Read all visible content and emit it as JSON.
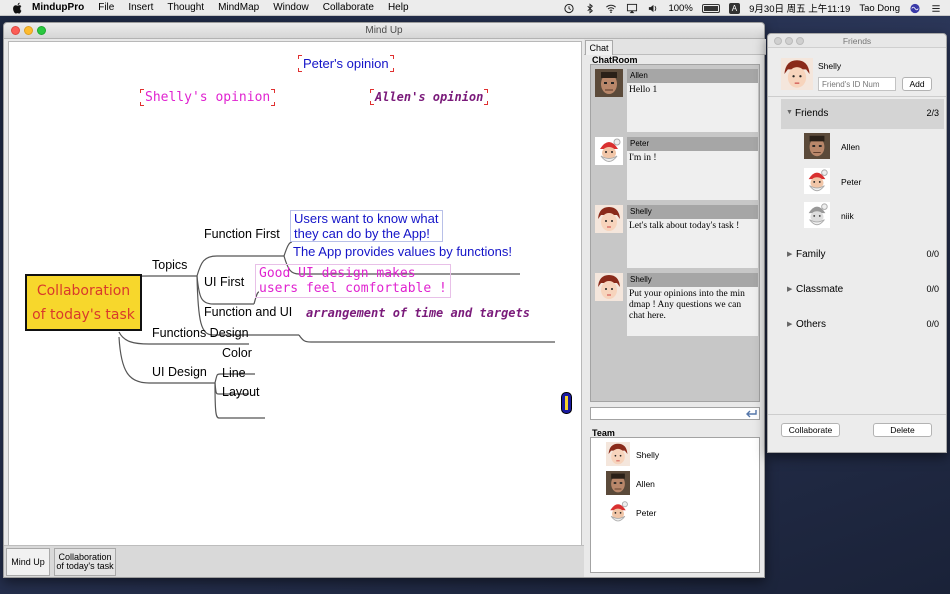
{
  "menubar": {
    "apple_icon": "apple-icon",
    "app_name": "MindupPro",
    "items": [
      "File",
      "Insert",
      "Thought",
      "MindMap",
      "Window",
      "Collaborate",
      "Help"
    ],
    "status": {
      "battery_label": "100%",
      "ime": "A",
      "datetime": "9月30日 周五 上午11:19",
      "user": "Tao Dong"
    }
  },
  "main_window": {
    "title": "Mind Up",
    "mindmap": {
      "root": [
        "Collaboration",
        "of today's task"
      ],
      "opinions": {
        "peter": "Peter's opinion",
        "shelly": "Shelly's opinion",
        "allen": "Allen's opinion"
      },
      "branches": {
        "topics": "Topics",
        "functions_design": "Functions Design",
        "ui_design": "UI Design",
        "function_first": "Function First",
        "ui_first": "UI First",
        "function_and_ui": "Function and UI",
        "color": "Color",
        "line": "Line",
        "layout": "Layout"
      },
      "notes": {
        "users_want_1": "Users want to know what",
        "users_want_2": "they can do by the App!",
        "app_provides": "The App provides values by functions!",
        "good_ui_1": "Good UI design makes",
        "good_ui_2": "users feel comfortable !",
        "arrangement": "arrangement of time and targets"
      }
    },
    "doc_tabs": {
      "mindup": "Mind Up",
      "collab_1": "Collaboration",
      "collab_2": "of today's task"
    },
    "chat": {
      "tab": "Chat",
      "chatroom_label": "ChatRoom",
      "team_label": "Team",
      "messages": [
        {
          "sender": "Allen",
          "text": "Hello 1"
        },
        {
          "sender": "Peter",
          "text": "I'm in !"
        },
        {
          "sender": "Shelly",
          "text": "Let's talk about today's task !"
        },
        {
          "sender": "Shelly",
          "text": "Put your opinions into the min dmap ! Any questions we can chat here."
        }
      ],
      "team": [
        "Shelly",
        "Allen",
        "Peter"
      ]
    }
  },
  "friends_window": {
    "title": "Friends",
    "me": "Shelly",
    "id_placeholder": "Friend's ID Num",
    "add_label": "Add",
    "groups": {
      "friends": {
        "name": "Friends",
        "count": "2/3",
        "members": [
          "Allen",
          "Peter",
          "niik"
        ]
      },
      "family": {
        "name": "Family",
        "count": "0/0"
      },
      "classmate": {
        "name": "Classmate",
        "count": "0/0"
      },
      "others": {
        "name": "Others",
        "count": "0/0"
      }
    },
    "collaborate_label": "Collaborate",
    "delete_label": "Delete"
  },
  "colors": {
    "root_fill": "#f7d72c",
    "root_text": "#d93a2b",
    "note_blue": "#1414c8",
    "note_pink": "#e023d0",
    "note_purple": "#7a1a7a"
  }
}
